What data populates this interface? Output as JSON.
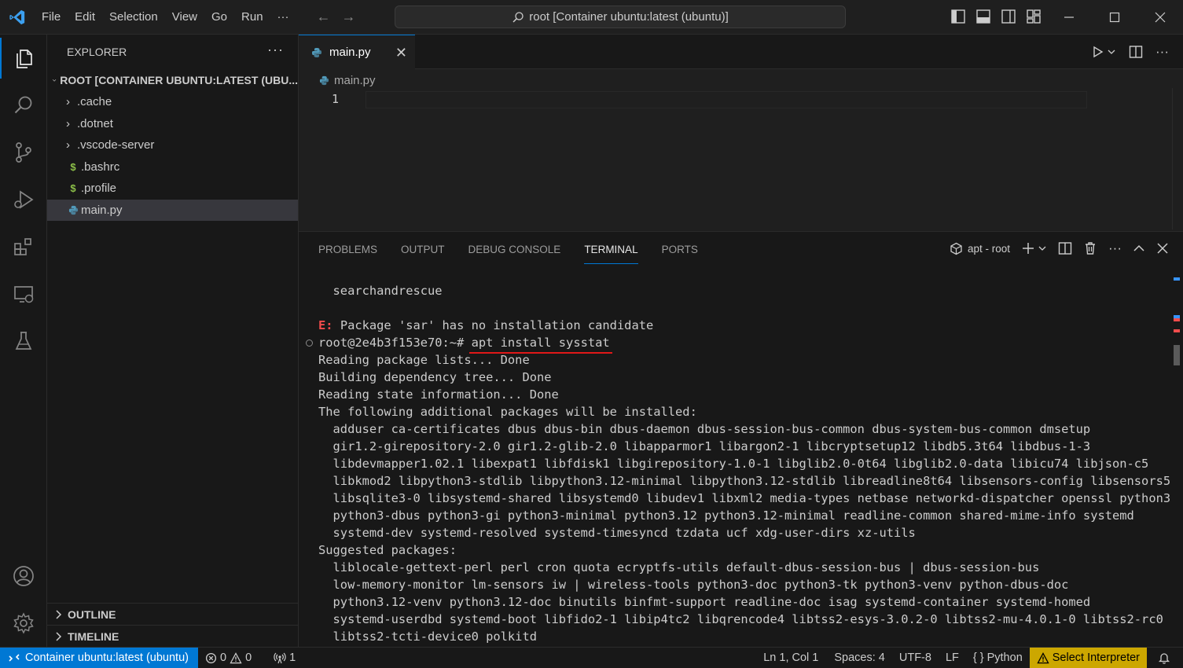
{
  "titlebar": {
    "menu": [
      "File",
      "Edit",
      "Selection",
      "View",
      "Go",
      "Run",
      "···"
    ],
    "command_center": "root [Container ubuntu:latest (ubuntu)]"
  },
  "explorer": {
    "title": "EXPLORER",
    "root": "ROOT [CONTAINER UBUNTU:LATEST (UBU...",
    "items": [
      {
        "label": ".cache",
        "kind": "folder"
      },
      {
        "label": ".dotnet",
        "kind": "folder"
      },
      {
        "label": ".vscode-server",
        "kind": "folder"
      },
      {
        "label": ".bashrc",
        "kind": "shell-file"
      },
      {
        "label": ".profile",
        "kind": "shell-file"
      },
      {
        "label": "main.py",
        "kind": "python-file",
        "selected": true
      }
    ],
    "outline": "OUTLINE",
    "timeline": "TIMELINE"
  },
  "editor": {
    "tab": "main.py",
    "breadcrumb": "main.py",
    "line_number": "1"
  },
  "panel": {
    "tabs": [
      "PROBLEMS",
      "OUTPUT",
      "DEBUG CONSOLE",
      "TERMINAL",
      "PORTS"
    ],
    "active_tab": "TERMINAL",
    "terminal_name": "apt - root"
  },
  "terminal": {
    "lines": [
      "  searchandrescue",
      "",
      "",
      "root@2e4b3f153e70:~# ",
      "Reading package lists... Done",
      "Building dependency tree... Done",
      "Reading state information... Done",
      "The following additional packages will be installed:",
      "  adduser ca-certificates dbus dbus-bin dbus-daemon dbus-session-bus-common dbus-system-bus-common dmsetup",
      "  gir1.2-girepository-2.0 gir1.2-glib-2.0 libapparmor1 libargon2-1 libcryptsetup12 libdb5.3t64 libdbus-1-3",
      "  libdevmapper1.02.1 libexpat1 libfdisk1 libgirepository-1.0-1 libglib2.0-0t64 libglib2.0-data libicu74 libjson-c5",
      "  libkmod2 libpython3-stdlib libpython3.12-minimal libpython3.12-stdlib libreadline8t64 libsensors-config libsensors5",
      "  libsqlite3-0 libsystemd-shared libsystemd0 libudev1 libxml2 media-types netbase networkd-dispatcher openssl python3",
      "  python3-dbus python3-gi python3-minimal python3.12 python3.12-minimal readline-common shared-mime-info systemd",
      "  systemd-dev systemd-resolved systemd-timesyncd tzdata ucf xdg-user-dirs xz-utils",
      "Suggested packages:",
      "  liblocale-gettext-perl perl cron quota ecryptfs-utils default-dbus-session-bus | dbus-session-bus",
      "  low-memory-monitor lm-sensors iw | wireless-tools python3-doc python3-tk python3-venv python-dbus-doc",
      "  python3.12-venv python3.12-doc binutils binfmt-support readline-doc isag systemd-container systemd-homed",
      "  systemd-userdbd systemd-boot libfido2-1 libip4tc2 libqrencode4 libtss2-esys-3.0.2-0 libtss2-mu-4.0.1-0 libtss2-rc0",
      "  libtss2-tcti-device0 polkitd"
    ],
    "error_prefix": "E:",
    "error_message": " Package 'sar' has no installation candidate",
    "command": "apt install sysstat"
  },
  "statusbar": {
    "remote": "Container ubuntu:latest (ubuntu)",
    "errors": "0",
    "warnings": "0",
    "ports": "1",
    "position": "Ln 1, Col 1",
    "spaces": "Spaces: 4",
    "encoding": "UTF-8",
    "eol": "LF",
    "language": "Python",
    "interpreter": "Select Interpreter"
  },
  "colors": {
    "accent": "#0078d4",
    "warning_badge": "#cca700",
    "error_text": "#f14c4c",
    "annotation_underline": "#e01818"
  }
}
